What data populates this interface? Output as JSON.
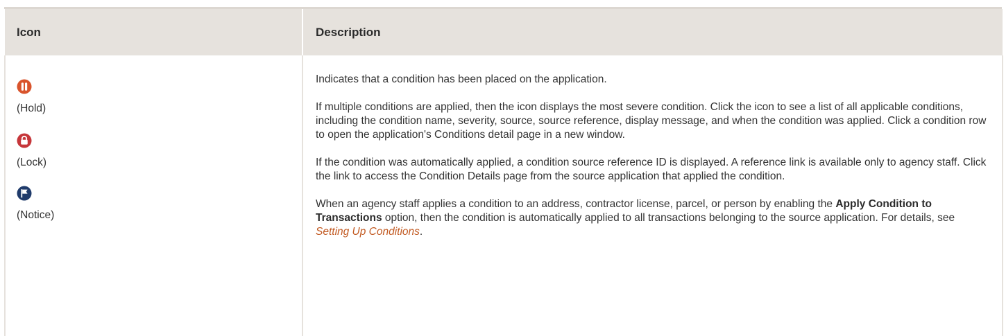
{
  "table": {
    "headers": {
      "icon": "Icon",
      "description": "Description"
    },
    "icons": [
      {
        "name": "hold-icon",
        "label": "(Hold)",
        "color": "#d9542c"
      },
      {
        "name": "lock-icon",
        "label": "(Lock)",
        "color": "#c6363a"
      },
      {
        "name": "notice-icon",
        "label": "(Notice)",
        "color": "#1f3b6b"
      }
    ],
    "description": {
      "p1": "Indicates that a condition has been placed on the application.",
      "p2": "If multiple conditions are applied, then the icon displays the most severe condition. Click the icon to see a list of all applicable conditions, including the condition name, severity, source, source reference,  display message, and when the condition was applied. Click a condition row to open the application's Conditions detail page in a new window.",
      "p3": "If the condition was automatically applied, a condition source reference ID is displayed. A reference link is available only to agency staff. Click the link to access the Condition Details page from the source application that applied the condition.",
      "p4_before": "When an agency staff applies a condition to an address, contractor license, parcel, or person by enabling the ",
      "p4_bold": "Apply Condition to Transactions",
      "p4_after": " option, then the condition is automatically applied to all transactions belonging to the source application. For details, see ",
      "p4_link": "Setting Up Conditions",
      "p4_end": "."
    }
  }
}
